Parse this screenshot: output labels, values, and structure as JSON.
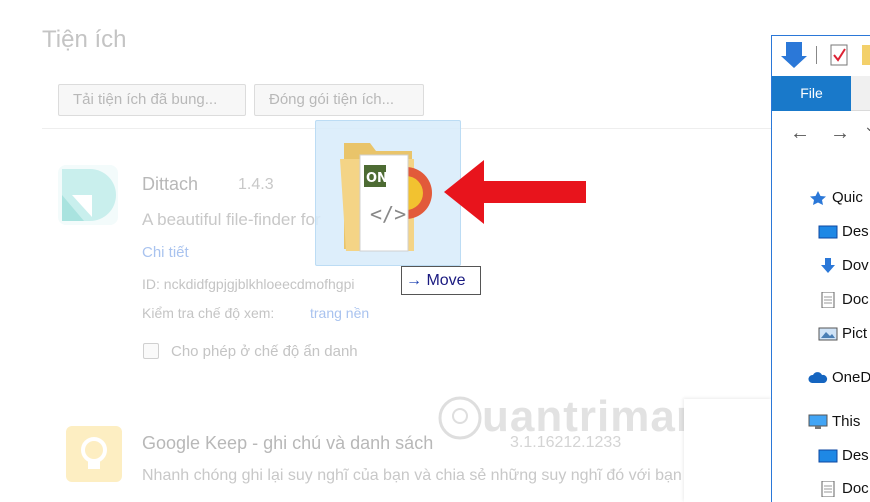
{
  "page": {
    "title": "Tiện ích",
    "buttons": {
      "load_unpacked": "Tải tiện ích đã bung...",
      "pack": "Đóng gói tiện ích..."
    }
  },
  "extensions": [
    {
      "name": "Dittach",
      "version": "1.4.3",
      "description": "A beautiful file-finder for",
      "details_link": "Chi tiết",
      "id_text": "ID: nckdidfgpjgjblkhloeecdmofhgpi",
      "inspect_label": "Kiểm tra chế độ xem:",
      "inspect_link": "trang nền",
      "incognito_label": "Cho phép ở chế độ ẩn danh"
    },
    {
      "name": "Google Keep - ghi chú và danh sách",
      "version": "3.1.16212.1233",
      "description": "Nhanh chóng ghi lại suy nghĩ của bạn và chia sẻ những suy nghĩ đó với bạn"
    }
  ],
  "drag": {
    "tooltip_arrow": "→",
    "tooltip_label": "Move",
    "file_label": "ON"
  },
  "watermark": "uantrimang",
  "explorer": {
    "file_tab": "File",
    "back_arrow": "←",
    "forward_arrow": "→",
    "recent_chevron": "⌄",
    "nav": [
      {
        "label": "Quic"
      },
      {
        "label": "Des"
      },
      {
        "label": "Dov"
      },
      {
        "label": "Doc"
      },
      {
        "label": "Pict"
      },
      {
        "label": "OneD"
      },
      {
        "label": "This"
      },
      {
        "label": "Des"
      },
      {
        "label": "Doc"
      }
    ]
  },
  "colors": {
    "accent_blue": "#1979ca",
    "arrow_red": "#e8141c",
    "link_blue": "#a9c3ef"
  }
}
